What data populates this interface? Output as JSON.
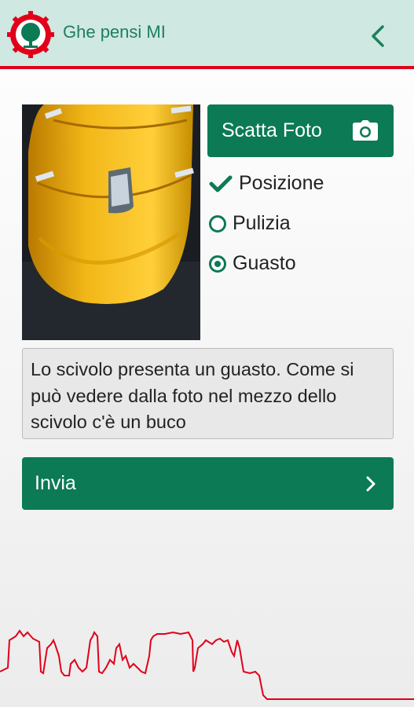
{
  "header": {
    "app_title": "Ghe pensi MI",
    "logo_icon": "tree-logo-icon",
    "back_icon": "chevron-left-icon",
    "accent": "#1f7f5c",
    "bar_color": "#cfe8e1",
    "border_color": "#e1001a"
  },
  "photo": {
    "icon": "slide-photo"
  },
  "camera_button": {
    "label": "Scatta Foto",
    "icon": "camera-icon"
  },
  "options": [
    {
      "label": "Posizione",
      "icon": "check-icon",
      "state": "done"
    },
    {
      "label": "Pulizia",
      "icon": "radio-icon",
      "state": "unchecked"
    },
    {
      "label": "Guasto",
      "icon": "radio-icon",
      "state": "checked"
    }
  ],
  "description": {
    "value": "Lo scivolo presenta un guasto. Come si può vedere dalla foto nel mezzo dello scivolo c'è un buco"
  },
  "send_button": {
    "label": "Invia",
    "icon": "chevron-right-icon"
  },
  "theme": {
    "primary": "#0b7a55",
    "skyline": "#e1001a"
  }
}
